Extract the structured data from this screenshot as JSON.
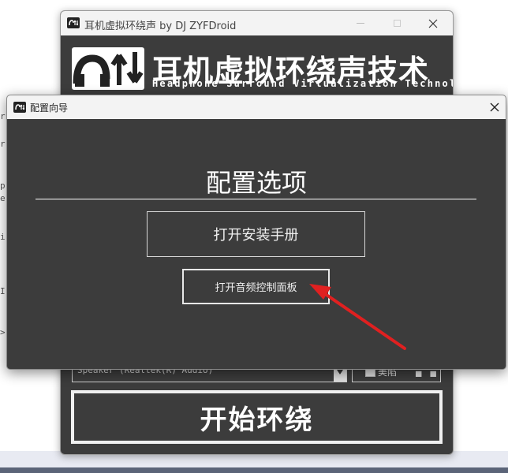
{
  "main_window": {
    "title": "耳机虚拟环绕声 by DJ ZYFDroid",
    "banner": {
      "title": "耳机虚拟环绕声技术",
      "subtitle": "Headphone Surround Virtualization Technology"
    },
    "device": {
      "selected": "Speaker (Realtek(R) Audio)"
    },
    "option": {
      "label": "美陷",
      "extra": "▄ ▄"
    },
    "start_button": "开始环绕"
  },
  "dialog": {
    "title": "配置向导",
    "heading": "配置选项",
    "buttons": {
      "manual": "打开安装手册",
      "audio_panel": "打开音频控制面板"
    }
  },
  "background_code": [
    "r",
    "r",
    "p",
    "e",
    "i",
    "I",
    ">"
  ],
  "colors": {
    "window_bg": "#3c3c3c",
    "titlebar": "#f3f3f3",
    "annotation_arrow": "#e02020"
  }
}
